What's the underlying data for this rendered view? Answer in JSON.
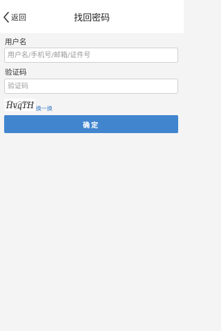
{
  "header": {
    "back_label": "返回",
    "title": "找回密码",
    "back_icon": "chevron-left-icon"
  },
  "form": {
    "username": {
      "label": "用户名",
      "placeholder": "用户名/手机号/邮箱/证件号",
      "value": ""
    },
    "code": {
      "label": "验证码",
      "placeholder": "验证码",
      "value": ""
    },
    "captcha": {
      "image_text": "HvqTH",
      "refresh_label": "换一换"
    },
    "submit_label": "确定"
  },
  "colors": {
    "accent": "#4185cf",
    "link": "#3f80c8",
    "page_bg": "#f4f4f4"
  }
}
